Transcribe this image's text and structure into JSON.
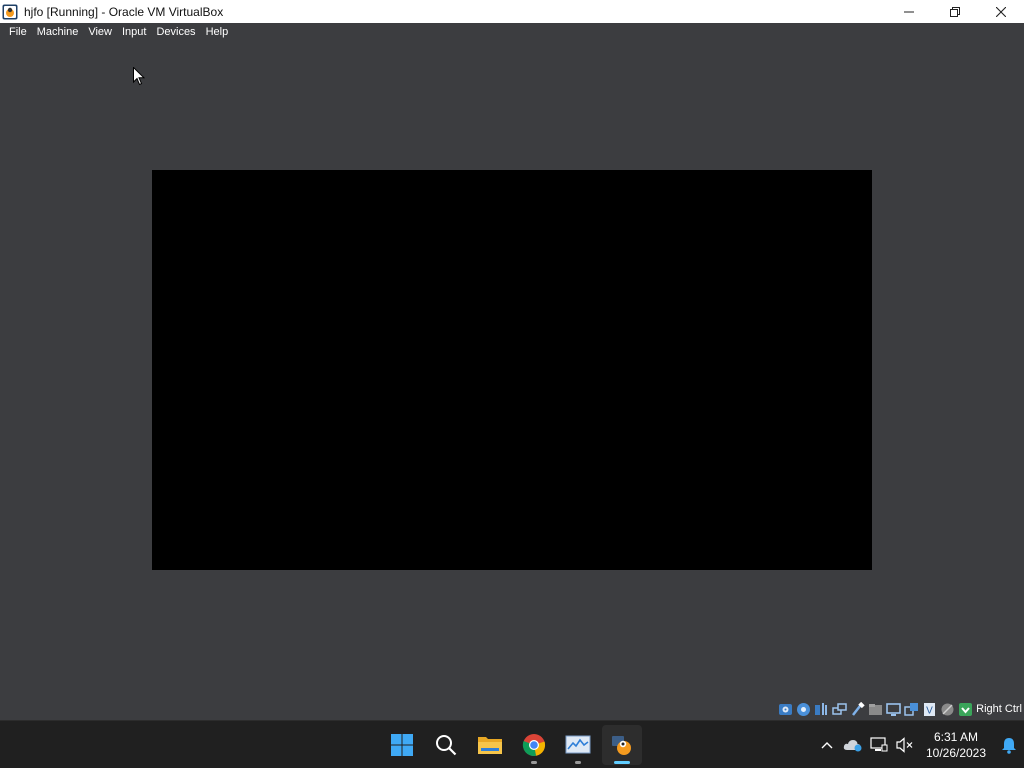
{
  "window": {
    "title": "hjfo [Running] - Oracle VM VirtualBox",
    "controls": [
      "minimize",
      "maximize",
      "close"
    ]
  },
  "menu": [
    "File",
    "Machine",
    "View",
    "Input",
    "Devices",
    "Help"
  ],
  "vm": {
    "state": "Running",
    "screen_color": "#000000",
    "background_color": "#3c3d40"
  },
  "statusbar": {
    "icons": [
      "hard-disk-icon",
      "optical-drive-icon",
      "audio-icon",
      "network-icon",
      "usb-icon",
      "shared-folders-icon",
      "display-icon",
      "video-capture-icon",
      "virtualization-icon",
      "mouse-integration-icon",
      "keyboard-icon"
    ],
    "host_key": "Right Ctrl"
  },
  "taskbar": {
    "apps": [
      "start",
      "search",
      "file-explorer",
      "chrome",
      "performance-monitor",
      "virtualbox"
    ],
    "active_app": "virtualbox",
    "time": "6:31 AM",
    "date": "10/26/2023"
  },
  "colors": {
    "accent": "#60cdff",
    "taskbar": "#202020",
    "titlebar": "#ffffff"
  }
}
